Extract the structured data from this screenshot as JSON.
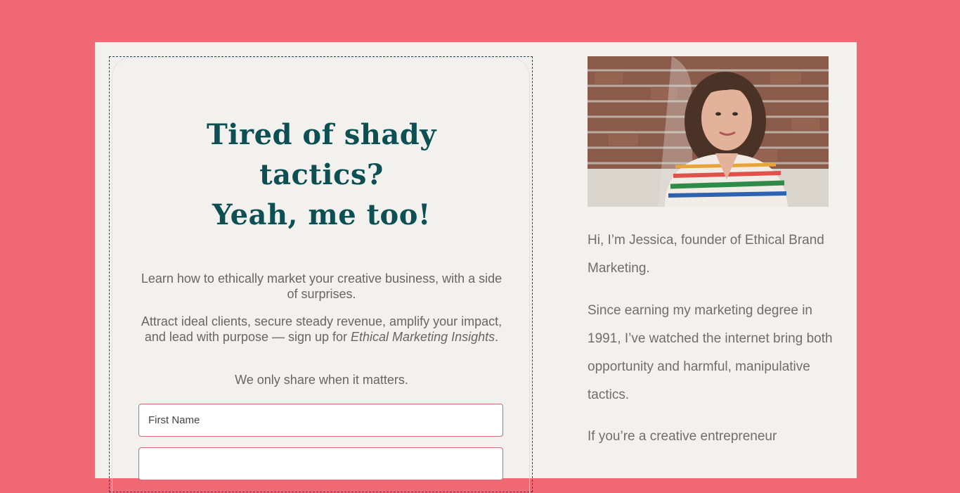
{
  "signup": {
    "headline_line1": "Tired of shady",
    "headline_line2": "tactics?",
    "headline_line3": "Yeah, me too!",
    "intro": "Learn how to ethically market your creative business, with a side of surprises.",
    "pitch_before": "Attract ideal clients, secure steady revenue, amplify your impact, and lead with purpose — sign up for ",
    "pitch_newsletter": "Ethical Marketing Insights",
    "pitch_after": ".",
    "frequency_note": "We only share when it matters.",
    "first_name_placeholder": "First Name",
    "email_placeholder": ""
  },
  "about": {
    "photo_icon": "portrait-photo",
    "bio_p1": "Hi, I’m Jessica, founder of Ethical Brand Marketing.",
    "bio_p2": "Since earning my marketing degree in 1991, I’ve watched the internet bring both opportunity and harmful, manipulative tactics.",
    "bio_p3": "If you’re a creative entrepreneur"
  },
  "colors": {
    "background": "#ef6873",
    "card": "#f3f1ee",
    "headline": "#0d4f52",
    "field_border": "#d96571"
  }
}
